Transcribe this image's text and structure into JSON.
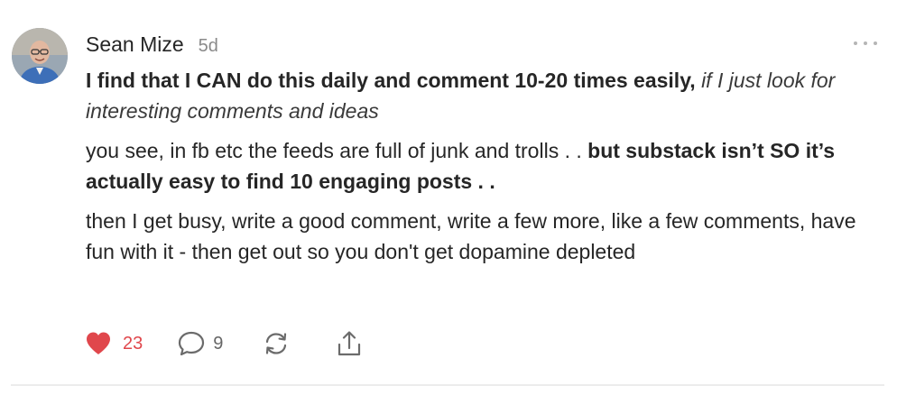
{
  "comment": {
    "author": "Sean Mize",
    "time_ago": "5d",
    "paragraphs": {
      "p1_bold": "I find that I CAN do this daily and comment 10-20 times easily,",
      "p1_italic": "if I just look for interesting comments and ideas",
      "p2_normal": "you see, in fb etc the feeds are full of junk and trolls . .",
      "p2_bold": "but substack isn’t SO it’s actually easy to find 10 engaging posts . .",
      "p3_normal": "then I get busy, write a good comment, write a few more, like a few comments, have fun with it - then get out so you don't get dopamine depleted"
    },
    "actions": {
      "like_count": "23",
      "comment_count": "9"
    }
  },
  "icons": {
    "like": "heart-icon",
    "comment": "speech-bubble-icon",
    "restack": "restack-icon",
    "share": "share-icon",
    "more": "more-options-icon"
  },
  "colors": {
    "like": "#e0474c",
    "muted": "#8a8a8a"
  }
}
